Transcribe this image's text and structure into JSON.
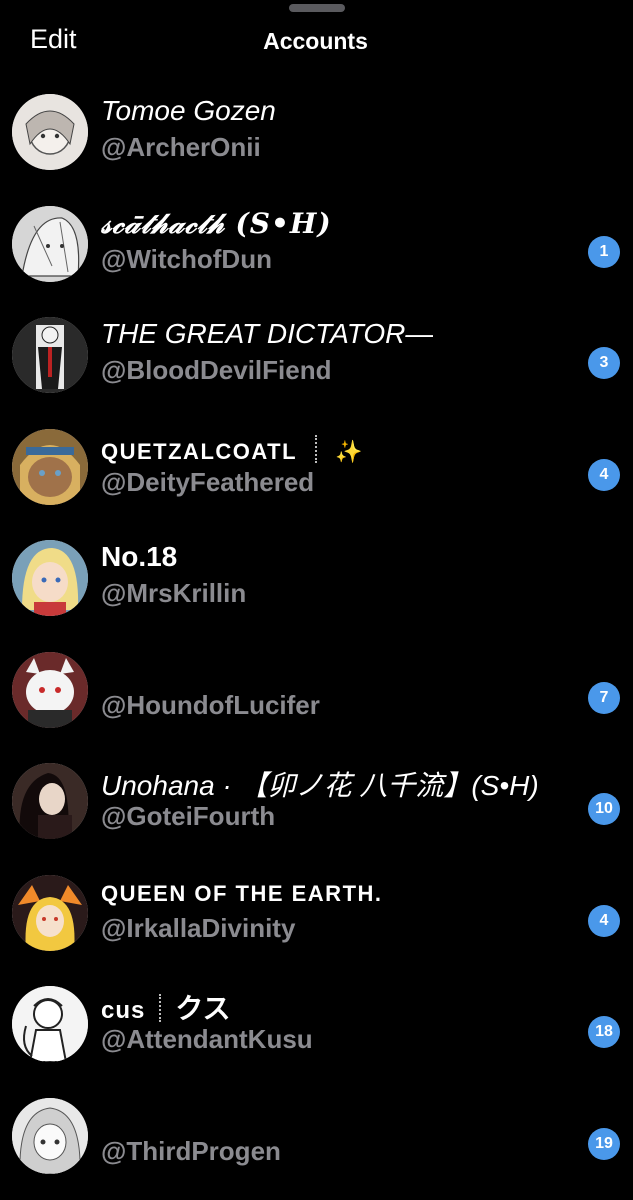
{
  "header": {
    "edit_label": "Edit",
    "title": "Accounts"
  },
  "accounts": [
    {
      "display_name": "Tomoe Gozen",
      "handle": "@ArcherOnii",
      "badge": null,
      "avatar_tone": "#d9d4d0"
    },
    {
      "display_name": "𝓈𝒸𝒶̄𝓉𝒽𝒶𝒸𝓉𝒽 (S•H)",
      "handle": "@WitchofDun",
      "badge": "1",
      "avatar_tone": "#c9c9c9"
    },
    {
      "display_name": "THE GREAT DICTATOR—",
      "handle": "@BloodDevilFiend",
      "badge": "3",
      "avatar_tone": "#7a7a7a"
    },
    {
      "display_name": "QUETZALCOATL",
      "display_suffix": "✨",
      "handle": "@DeityFeathered",
      "badge": "4",
      "avatar_tone": "#b88a4a"
    },
    {
      "display_name": "No.18",
      "handle": "@MrsKrillin",
      "badge": null,
      "avatar_tone": "#e9d27a"
    },
    {
      "display_name": "",
      "handle": "@HoundofLucifer",
      "badge": "7",
      "avatar_tone": "#9b3a3a"
    },
    {
      "display_name": "Unohana · 【卯ノ花 八千流】(S•H)",
      "handle": "@GoteiFourth",
      "badge": "10",
      "avatar_tone": "#3a2a2a"
    },
    {
      "display_name": "QUEEN OF THE EARTH.",
      "handle": "@IrkallaDivinity",
      "badge": "4",
      "avatar_tone": "#c86a2a"
    },
    {
      "display_name": "cus",
      "display_suffix": "クス",
      "handle": "@AttendantKusu",
      "badge": "18",
      "avatar_tone": "#e6e6e6"
    },
    {
      "display_name": "",
      "handle": "@ThirdProgen",
      "badge": "19",
      "avatar_tone": "#dcdcdc"
    }
  ]
}
